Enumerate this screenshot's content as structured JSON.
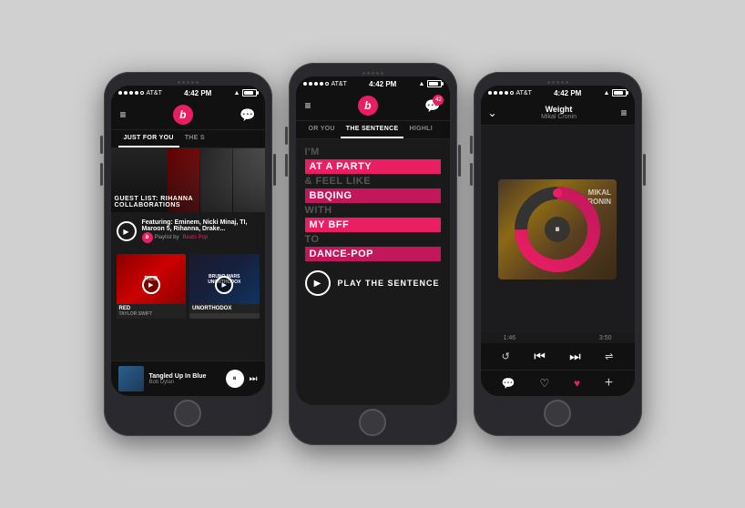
{
  "phones": [
    {
      "id": "phone1",
      "status": {
        "carrier": "AT&T",
        "time": "4:42 PM",
        "signal_dots": 5,
        "battery": 80
      },
      "nav": {
        "logo": "b",
        "left_icon": "≡",
        "right_icon": "💬"
      },
      "tabs": [
        {
          "label": "JUST FOR YOU",
          "active": true
        },
        {
          "label": "THE S",
          "active": false
        }
      ],
      "featured": {
        "title": "GUEST LIST: RIHANNA COLLABORATIONS"
      },
      "playlist": {
        "title": "Featuring: Eminem, Nicki Minaj, TI, Maroon 5, Rihanna, Drake...",
        "subtitle": "Playlist by",
        "badge": "Beats Pop"
      },
      "albums": [
        {
          "title": "RED",
          "artist": "TAYLOR SWIFT",
          "type": "red"
        },
        {
          "title": "UNORTHODOX",
          "artist": "BRUNO MARS",
          "type": "dark"
        }
      ],
      "player": {
        "song": "Tangled Up In Blue",
        "artist": "Bob Dylan"
      }
    },
    {
      "id": "phone2",
      "status": {
        "carrier": "AT&T",
        "time": "4:42 PM",
        "signal_dots": 5,
        "battery": 80
      },
      "nav": {
        "logo": "b",
        "left_icon": "≡",
        "right_icon": "💬",
        "badge": "42"
      },
      "tabs": [
        {
          "label": "OR YOU",
          "active": false
        },
        {
          "label": "THE SENTENCE",
          "active": true
        },
        {
          "label": "HIGHLI",
          "active": false
        }
      ],
      "sentence": {
        "lines": [
          {
            "text": "I'M",
            "highlight": false
          },
          {
            "text": "AT A PARTY",
            "highlight": true
          },
          {
            "text": "& FEEL LIKE",
            "highlight": false
          },
          {
            "text": "BBQING",
            "highlight": true
          },
          {
            "text": "WITH",
            "highlight": false
          },
          {
            "text": "MY BFF",
            "highlight": true
          },
          {
            "text": "TO",
            "highlight": false
          },
          {
            "text": "DANCE-POP",
            "highlight": true
          }
        ],
        "play_label": "PLAY THE SENTENCE"
      }
    },
    {
      "id": "phone3",
      "status": {
        "carrier": "AT&T",
        "time": "4:42 PM",
        "signal_dots": 5,
        "battery": 80
      },
      "nav": {
        "back_icon": "∨",
        "list_icon": "≡"
      },
      "now_playing": {
        "song": "Weight",
        "artist": "Mikal Cronin",
        "elapsed": "1:46",
        "total": "3:50",
        "progress_pct": 47,
        "album_text": "MIKAL\nCRONIN"
      },
      "controls": {
        "repeat": "↺",
        "prev": "⏮",
        "next": "⏭",
        "shuffle": "⇌"
      },
      "actions": {
        "chat": "💬",
        "heart": "♡",
        "heart_fill": "♥",
        "plus": "+"
      }
    }
  ]
}
